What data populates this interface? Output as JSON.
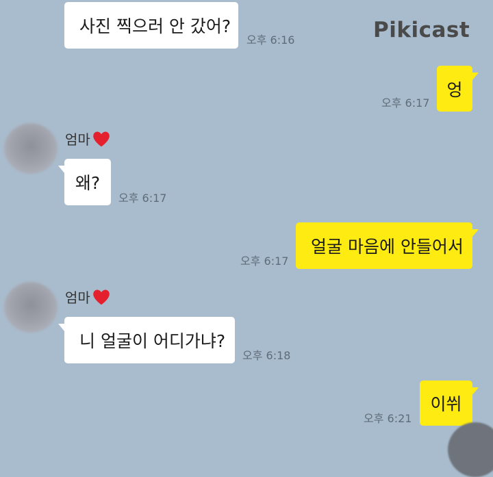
{
  "watermark": {
    "text": "Pikicast"
  },
  "colors": {
    "background": "#a9bccd",
    "incoming_bubble": "#ffffff",
    "outgoing_bubble": "#fdeb12",
    "heart": "#e5202e"
  },
  "messages": [
    {
      "direction": "in",
      "text": "사진 찍으러 안 갔어?",
      "time": "오후 6:16"
    },
    {
      "direction": "out",
      "text": "엉",
      "time": "오후 6:17"
    },
    {
      "direction": "in",
      "sender": "엄마",
      "sender_icon": "heart-icon",
      "text": "왜?",
      "time": "오후 6:17"
    },
    {
      "direction": "out",
      "text": "얼굴 마음에 안들어서",
      "time": "오후 6:17"
    },
    {
      "direction": "in",
      "sender": "엄마",
      "sender_icon": "heart-icon",
      "text": "니 얼굴이 어디가냐?",
      "time": "오후 6:18"
    },
    {
      "direction": "out",
      "text": "이쒸",
      "time": "오후 6:21"
    }
  ]
}
